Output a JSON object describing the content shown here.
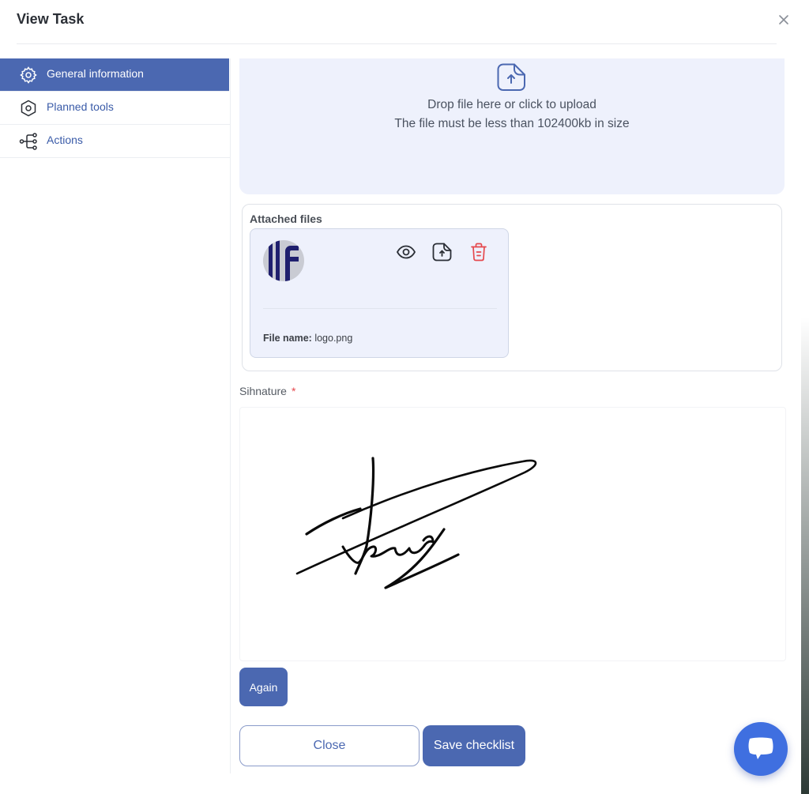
{
  "modal": {
    "title": "View Task"
  },
  "sidebar": {
    "items": [
      {
        "label": "General information",
        "icon": "gear-icon",
        "active": true
      },
      {
        "label": "Planned tools",
        "icon": "hexagon-icon",
        "active": false
      },
      {
        "label": "Actions",
        "icon": "branch-icon",
        "active": false
      }
    ]
  },
  "upload": {
    "icon": "upload-file-icon",
    "line1": "Drop file here or click to upload",
    "line2": "The file must be less than 102400kb in size"
  },
  "attached": {
    "title": "Attached files",
    "files": [
      {
        "name_label": "File name:",
        "name": "logo.png",
        "thumbnail": "logo-thumbnail",
        "actions": [
          "eye-icon",
          "upload-file-icon",
          "trash-icon"
        ]
      }
    ]
  },
  "signature": {
    "label": "Sihnature",
    "required_mark": "*"
  },
  "buttons": {
    "again": "Again",
    "close": "Close",
    "save": "Save checklist"
  },
  "chat": {
    "icon": "chat-icon"
  },
  "colors": {
    "primary": "#4b68b1",
    "dropzone_bg": "#eef1fc",
    "danger": "#e5484d",
    "chat": "#3f6fe0"
  }
}
